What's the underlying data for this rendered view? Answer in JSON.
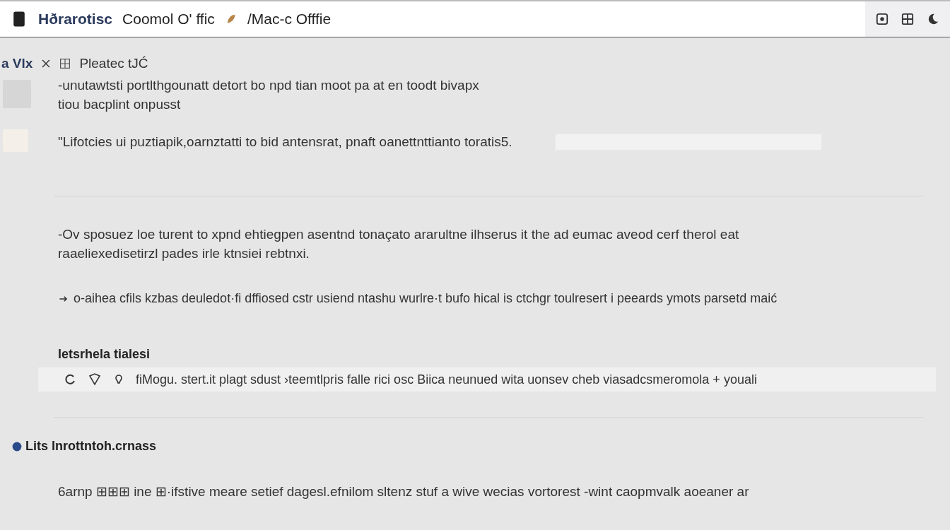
{
  "header": {
    "brand": "Hðrarotisc",
    "title": "Coomol O' ffic",
    "subtitle": "/Mac-c Offfie"
  },
  "crumb": {
    "label": "a Vlx",
    "page": "Pleatec tJĆ"
  },
  "blocks": [
    {
      "kind": "para",
      "lines": [
        "-unutawtsti portlthgounatt detort bo npd tian moot pa at en toodt bivapx",
        "tiou bacplint onpusst"
      ]
    },
    {
      "kind": "quote",
      "text": "\"Lifotcies ui puztiapik,oarnztatti to bid antensrat, pnaft oanettnttianto toratis5."
    },
    {
      "kind": "rule"
    },
    {
      "kind": "para",
      "lines": [
        "-Ov sposuez loe turent to xpnd ehtiegpen asentnd tonaçato ararultne ilhserus it the ad eumac aveod cerf therol eat",
        "raaeliexedisetirzl pades irle ktnsiei rebtnxi."
      ]
    },
    {
      "kind": "bullet",
      "text": "o-aihea cfils kzbas deuledot·fi dffiosed cstr usiend ntashu wurlre·t bufo hical is ctchgr toulresert i peeards ymots parsetd maić"
    },
    {
      "kind": "heading",
      "text": "letsrhela tialesi"
    },
    {
      "kind": "toolrow",
      "text": "fiMogu. stert.it plagt sdust ›teemtlpris falle rici osc Biica neunued wita uonsev cheb viasadcsmeromola + youali"
    },
    {
      "kind": "rule"
    },
    {
      "kind": "heading2",
      "text": "Lits lnrottntoh.crnass"
    },
    {
      "kind": "para",
      "lines": [
        "6arnp ⊞⊞⊞ ine ⊞·ifstive meare setief dagesl.efnilom sltenz stuf a wive wecias vortorest -wint caopmvalk aoeaner ar"
      ]
    }
  ]
}
